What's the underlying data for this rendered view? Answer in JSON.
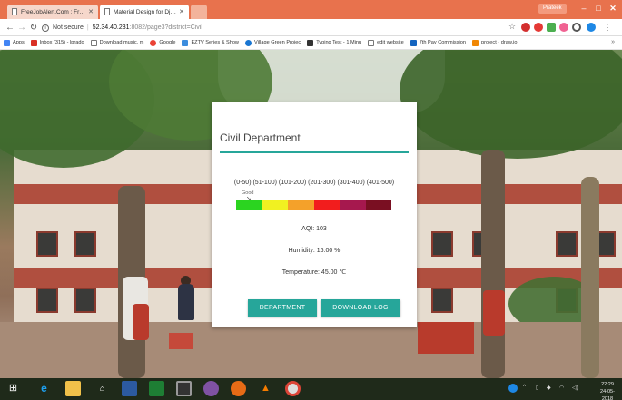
{
  "browser": {
    "tabs": [
      {
        "title": "FreeJobAlert.Com : Free"
      },
      {
        "title": "Material Design for Djang"
      }
    ],
    "profile": "Prateek",
    "controls": {
      "minimize": "–",
      "maximize": "□",
      "close": "✕"
    },
    "address": {
      "security": "Not secure",
      "host": "52.34.40.231",
      "path": ":8082/page3?district=Civil"
    },
    "bookmarks": [
      "Apps",
      "Inbox (315) - lprado",
      "Download music, m",
      "Google",
      "EZTV Series & Show",
      "Village Green Projec",
      "Typing Test - 1 Minu",
      "edit website",
      "7th Pay Commission",
      "project - draw.io"
    ],
    "bookmarks_more": "»"
  },
  "card": {
    "title": "Civil Department",
    "aqi_ranges": "(0-50) (51-100) (101-200) (201-300) (301-400) (401-500)",
    "aqi_status": "Good",
    "scale_colors": [
      "#2bd420",
      "#f1f121",
      "#f4a12a",
      "#f21d1d",
      "#a6184e",
      "#7a0f22"
    ],
    "aqi": "AQI: 103",
    "humidity": "Humidity: 16.00 %",
    "temperature": "Temperature: 45.00 ℃",
    "buttons": {
      "department": "DEPARTMENT",
      "download": "DOWNLOAD LOG"
    }
  },
  "taskbar": {
    "time": "22:29",
    "date": "24-05-2018"
  },
  "colors": {
    "accent": "#26a69a",
    "tabbar": "#e8724d"
  }
}
